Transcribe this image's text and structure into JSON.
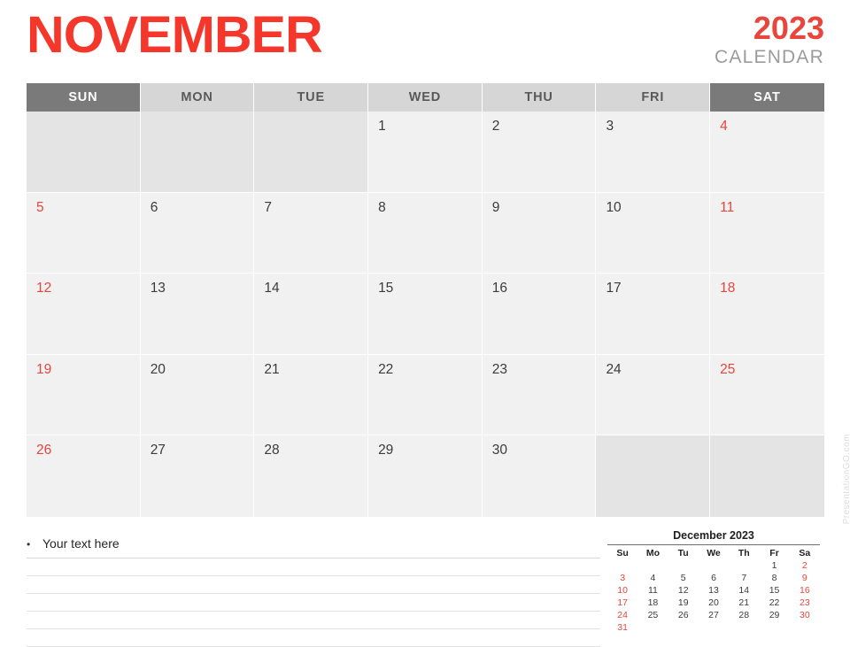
{
  "header": {
    "month": "NOVEMBER",
    "year": "2023",
    "calendar_word": "CALENDAR",
    "accent_color": "#F4372A",
    "weekend_color": "#E8453C"
  },
  "weekdays": [
    {
      "label": "SUN",
      "weekend": true
    },
    {
      "label": "MON",
      "weekend": false
    },
    {
      "label": "TUE",
      "weekend": false
    },
    {
      "label": "WED",
      "weekend": false
    },
    {
      "label": "THU",
      "weekend": false
    },
    {
      "label": "FRI",
      "weekend": false
    },
    {
      "label": "SAT",
      "weekend": true
    }
  ],
  "weeks": [
    [
      "",
      "",
      "",
      "1",
      "2",
      "3",
      "4"
    ],
    [
      "5",
      "6",
      "7",
      "8",
      "9",
      "10",
      "11"
    ],
    [
      "12",
      "13",
      "14",
      "15",
      "16",
      "17",
      "18"
    ],
    [
      "19",
      "20",
      "21",
      "22",
      "23",
      "24",
      "25"
    ],
    [
      "26",
      "27",
      "28",
      "29",
      "30",
      "",
      ""
    ]
  ],
  "notes": {
    "bullet": "•",
    "first_line": "Your text here",
    "extra_lines": 5
  },
  "mini_calendar": {
    "title": "December 2023",
    "weekdays": [
      "Su",
      "Mo",
      "Tu",
      "We",
      "Th",
      "Fr",
      "Sa"
    ],
    "weeks": [
      [
        "",
        "",
        "",
        "",
        "",
        "1",
        "2"
      ],
      [
        "3",
        "4",
        "5",
        "6",
        "7",
        "8",
        "9"
      ],
      [
        "10",
        "11",
        "12",
        "13",
        "14",
        "15",
        "16"
      ],
      [
        "17",
        "18",
        "19",
        "20",
        "21",
        "22",
        "23"
      ],
      [
        "24",
        "25",
        "26",
        "27",
        "28",
        "29",
        "30"
      ],
      [
        "31",
        "",
        "",
        "",
        "",
        "",
        ""
      ]
    ]
  },
  "watermark": "PresentationGO.com"
}
